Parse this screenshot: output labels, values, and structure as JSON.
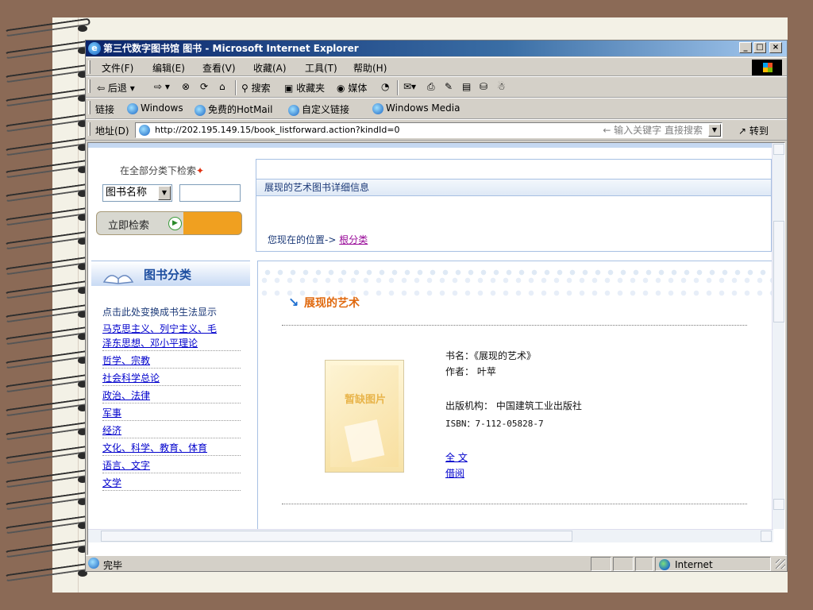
{
  "window": {
    "title": "第三代数字图书馆 图书 - Microsoft Internet Explorer",
    "controls": [
      "_",
      "□",
      "×"
    ]
  },
  "menu": [
    "文件(F)",
    "编辑(E)",
    "查看(V)",
    "收藏(A)",
    "工具(T)",
    "帮助(H)"
  ],
  "toolbar": {
    "back": "后退",
    "search": "搜索",
    "favorites": "收藏夹",
    "media": "媒体"
  },
  "links": {
    "label": "链接",
    "items": [
      "Windows",
      "免费的HotMail",
      "自定义链接",
      "Windows Media"
    ]
  },
  "address": {
    "label": "地址(D)",
    "url": "http://202.195.149.15/book_listforward.action?kindId=0",
    "search_hint": "← 输入关键字 直接搜索",
    "go": "转到"
  },
  "search_panel": {
    "title": "在全部分类下检索",
    "select_value": "图书名称",
    "input_value": "",
    "button": "立即检索"
  },
  "info_panel": {
    "header": "展现的艺术图书详细信息",
    "location_prefix": "您现在的位置->",
    "location_link": "根分类"
  },
  "category_panel": {
    "title": "图书分类",
    "switch": "点击此处变换成书生法显示",
    "items": [
      "马克思主义、列宁主义、毛",
      "泽东思想、邓小平理论",
      "哲学、宗教",
      "社会科学总论",
      "政治、法律",
      "军事",
      "经济",
      "文化、科学、教育、体育",
      "语言、文字",
      "文学"
    ]
  },
  "book": {
    "title": "展现的艺术",
    "cover_placeholder": "暂缺图片",
    "name_line": "书名：《展现的艺术》",
    "author_line": "作者： 叶苹",
    "publisher_line": "出版机构： 中国建筑工业出版社",
    "isbn_line": "ISBN：7-112-05828-7",
    "fulltext": "全 文",
    "borrow": "借阅"
  },
  "status": {
    "text": "完毕",
    "zone": "Internet"
  }
}
